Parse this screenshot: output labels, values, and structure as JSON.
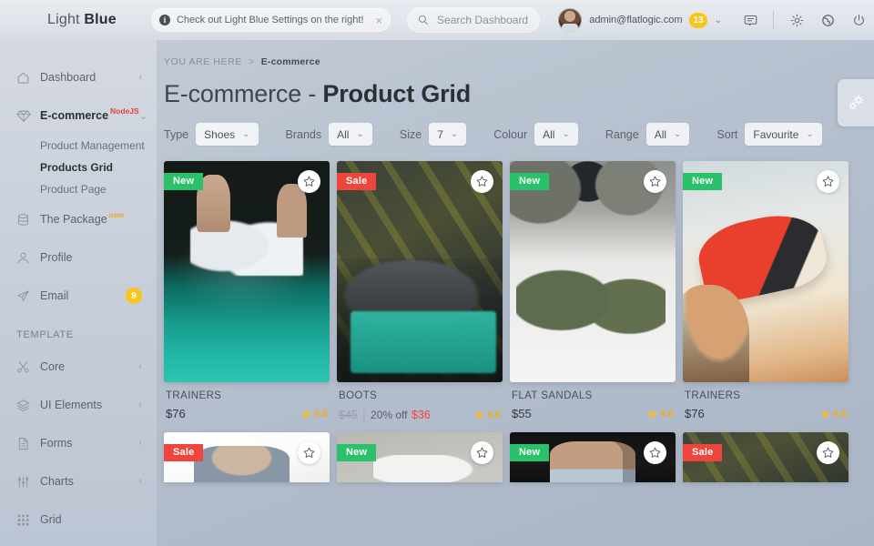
{
  "header": {
    "brand_light": "Light ",
    "brand_bold": "Blue",
    "notice_text": "Check out Light Blue Settings on the right!",
    "notice_info_glyph": "i",
    "notice_close_glyph": "×",
    "search_placeholder": "Search Dashboard",
    "search_value": "",
    "user_email": "admin@flatlogic.com",
    "user_badge": "13",
    "user_caret": "⌄",
    "icons": [
      "chat-icon",
      "gear-icon",
      "globe-icon",
      "power-icon"
    ]
  },
  "sidebar": {
    "items": [
      {
        "label": "Dashboard",
        "icon": "home-icon",
        "chevron": "‹",
        "tag": "",
        "tag_type": ""
      },
      {
        "label": "E-commerce",
        "icon": "diamond-icon",
        "chevron": "⌄",
        "tag": "NodeJS",
        "tag_type": "nodejs"
      }
    ],
    "subitems": [
      {
        "label": "Product Management",
        "active": false
      },
      {
        "label": "Products Grid",
        "active": true
      },
      {
        "label": "Product Page",
        "active": false
      }
    ],
    "items2": [
      {
        "label": "The Package",
        "icon": "database-icon",
        "tag": "new",
        "tag_type": "new",
        "badge": ""
      },
      {
        "label": "Profile",
        "icon": "user-icon",
        "tag": "",
        "tag_type": "",
        "badge": ""
      },
      {
        "label": "Email",
        "icon": "send-icon",
        "tag": "",
        "tag_type": "",
        "badge": "9"
      }
    ],
    "section_label": "TEMPLATE",
    "template_items": [
      {
        "label": "Core",
        "icon": "scissors-icon",
        "chevron": "‹"
      },
      {
        "label": "UI Elements",
        "icon": "layers-icon",
        "chevron": "‹"
      },
      {
        "label": "Forms",
        "icon": "file-icon",
        "chevron": "‹"
      },
      {
        "label": "Charts",
        "icon": "chart-icon",
        "chevron": "‹"
      },
      {
        "label": "Grid",
        "icon": "grid-icon",
        "chevron": ""
      }
    ]
  },
  "main": {
    "breadcrumb_prefix": "YOU ARE HERE",
    "breadcrumb_sep": ">",
    "breadcrumb_current": "E-commerce",
    "title_light": "E-commerce - ",
    "title_bold": "Product Grid",
    "filters": [
      {
        "label": "Type",
        "value": "Shoes",
        "chevron": "⌄"
      },
      {
        "label": "Brands",
        "value": "All",
        "chevron": "⌄"
      },
      {
        "label": "Size",
        "value": "7",
        "chevron": "⌄"
      },
      {
        "label": "Colour",
        "value": "All",
        "chevron": "⌄"
      },
      {
        "label": "Range",
        "value": "All",
        "chevron": "⌄"
      },
      {
        "label": "Sort",
        "value": "Favourite",
        "chevron": "⌄"
      }
    ],
    "products": [
      {
        "name": "TRAINERS",
        "badge": "New",
        "badge_type": "new",
        "price": "$76",
        "old_price": "",
        "discount": "",
        "sale_price": "",
        "rating": "4.6",
        "photo": "ph-trainers-teal"
      },
      {
        "name": "BOOTS",
        "badge": "Sale",
        "badge_type": "sale",
        "price": "",
        "old_price": "$45",
        "discount": "20% off",
        "sale_price": "$36",
        "rating": "4.6",
        "photo": "ph-boots"
      },
      {
        "name": "FLAT SANDALS",
        "badge": "New",
        "badge_type": "new",
        "price": "$55",
        "old_price": "",
        "discount": "",
        "sale_price": "",
        "rating": "4.6",
        "photo": "ph-sandals"
      },
      {
        "name": "TRAINERS",
        "badge": "New",
        "badge_type": "new",
        "price": "$76",
        "old_price": "",
        "discount": "",
        "sale_price": "",
        "rating": "4.6",
        "photo": "ph-red"
      }
    ],
    "products_row2": [
      {
        "badge": "Sale",
        "badge_type": "sale",
        "photo": "ph-boot-white"
      },
      {
        "badge": "New",
        "badge_type": "new",
        "photo": "ph-grey-sand"
      },
      {
        "badge": "New",
        "badge_type": "new",
        "photo": "ph-dark-legs"
      },
      {
        "badge": "Sale",
        "badge_type": "sale",
        "photo": "ph-olive-streak"
      }
    ],
    "favourite_icon": "star-icon"
  },
  "settings_tab": {
    "icon": "gears-icon"
  },
  "colors": {
    "badge_new": "#29c16a",
    "badge_sale": "#f0453d",
    "accent_yellow": "#f8c51c",
    "rating": "#f3ad1c",
    "nodejs_tag": "#e8413c",
    "sale_price": "#f0453d"
  }
}
